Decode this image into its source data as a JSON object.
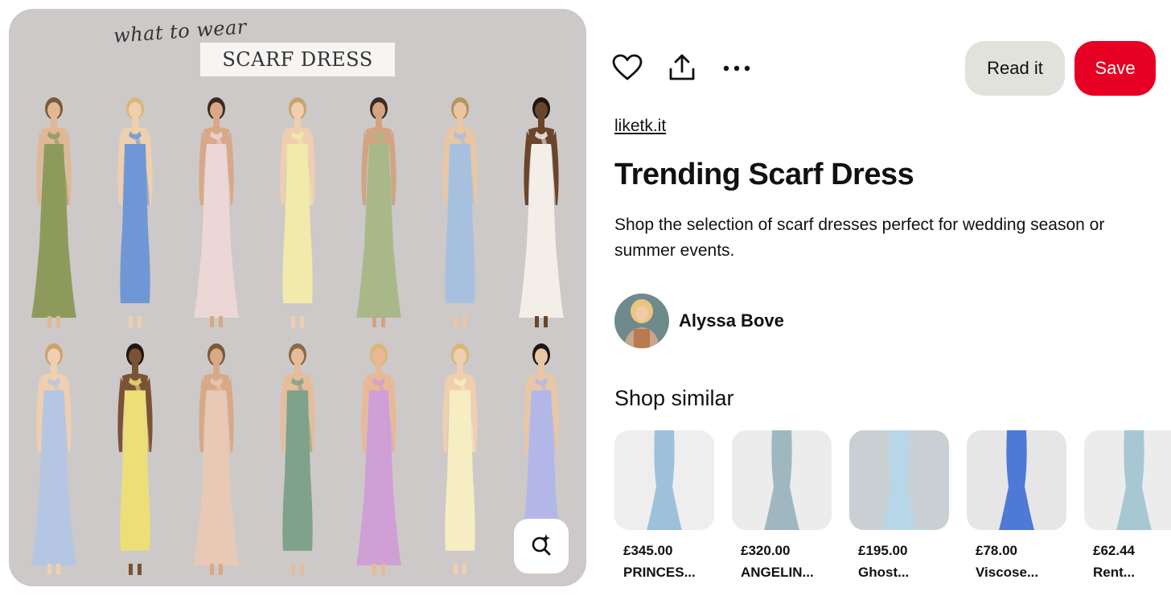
{
  "pin_image": {
    "handwritten_heading": "what to wear",
    "title_card": "SCARF DRESS",
    "row1_dresses": [
      {
        "color": "#8e9a5c",
        "skin": "#e0b896",
        "hair": "#7a5a3a"
      },
      {
        "color": "#6f97d6",
        "skin": "#f0cfae",
        "hair": "#d8b878"
      },
      {
        "color": "#ead7d6",
        "skin": "#d8a888",
        "hair": "#3b2a20"
      },
      {
        "color": "#f1eaaa",
        "skin": "#efcfb0",
        "hair": "#c9a46a"
      },
      {
        "color": "#a9b889",
        "skin": "#d2a482",
        "hair": "#3b2a20"
      },
      {
        "color": "#a7c0df",
        "skin": "#eac6a4",
        "hair": "#b9935d"
      },
      {
        "color": "#f3efe8",
        "skin": "#6a452c",
        "hair": "#1e1712"
      }
    ],
    "row2_dresses": [
      {
        "color": "#b5c6e2",
        "skin": "#efcfb0",
        "hair": "#c9a46a"
      },
      {
        "color": "#ecdf78",
        "skin": "#7a5236",
        "hair": "#1e1712"
      },
      {
        "color": "#e7c9b6",
        "skin": "#d9a886",
        "hair": "#7a5a3a"
      },
      {
        "color": "#7ea28a",
        "skin": "#e6bd9a",
        "hair": "#8c6a44"
      },
      {
        "color": "#cf9fd6",
        "skin": "#e8b994",
        "hair": "#d8b878"
      },
      {
        "color": "#f6edc2",
        "skin": "#efcfb0",
        "hair": "#d8b878"
      },
      {
        "color": "#b3b7e8",
        "skin": "#e8c7a6",
        "hair": "#1e1712"
      }
    ]
  },
  "actions": {
    "heart_icon": "heart-icon",
    "share_icon": "share-icon",
    "more_icon": "more-icon",
    "read_label": "Read it",
    "save_label": "Save",
    "save_color": "#e60023"
  },
  "pin": {
    "source": "liketk.it",
    "title": "Trending Scarf Dress",
    "description": "Shop the selection of scarf dresses perfect for wedding season or summer events.",
    "author": "Alyssa Bove"
  },
  "shop_similar": {
    "heading": "Shop similar",
    "products": [
      {
        "price": "£345.00",
        "name": "PRINCES...",
        "color": "#9ec1db",
        "bg": "#eeeeee"
      },
      {
        "price": "£320.00",
        "name": "ANGELIN...",
        "color": "#9fb8bf",
        "bg": "#ececec"
      },
      {
        "price": "£195.00",
        "name": "Ghost...",
        "color": "#b7d6e8",
        "bg": "#c9d0d4"
      },
      {
        "price": "£78.00",
        "name": "Viscose...",
        "color": "#4f79d6",
        "bg": "#e6e6e6"
      },
      {
        "price": "£62.44",
        "name": "Rent...",
        "color": "#a7c8d2",
        "bg": "#ececec"
      }
    ]
  }
}
